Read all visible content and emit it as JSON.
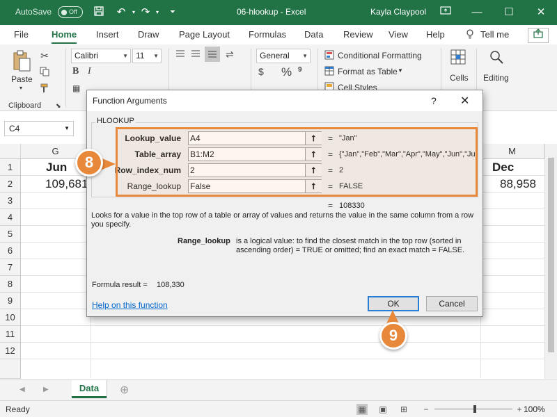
{
  "titlebar": {
    "autosave_label": "AutoSave",
    "autosave_state": "Off",
    "title": "06-hlookup  -  Excel",
    "user": "Kayla Claypool"
  },
  "ribbon_tabs": [
    "File",
    "Home",
    "Insert",
    "Draw",
    "Page Layout",
    "Formulas",
    "Data",
    "Review",
    "View",
    "Help"
  ],
  "tell_me": "Tell me",
  "ribbon": {
    "clipboard": {
      "paste": "Paste",
      "group": "Clipboard"
    },
    "font": {
      "name": "Calibri",
      "size": "11"
    },
    "number_format": "General",
    "styles": {
      "conditional": "Conditional Formatting",
      "format_table": "Format as Table",
      "cell_styles": "Cell Styles"
    },
    "cells": "Cells",
    "editing": "Editing"
  },
  "formula_bar": {
    "name_box": "C4"
  },
  "sheet": {
    "columns": [
      {
        "label": "G"
      },
      {
        "label": "M"
      }
    ],
    "rows": [
      "1",
      "2",
      "3",
      "4",
      "5",
      "6",
      "7",
      "8",
      "9",
      "10",
      "11",
      "12"
    ],
    "cells": {
      "g1": "Jun",
      "g2": "109,681",
      "m1": "Dec",
      "m2": "88,958"
    }
  },
  "sheet_tabs": [
    "Data"
  ],
  "status": {
    "ready": "Ready",
    "zoom": "100%"
  },
  "dialog": {
    "title": "Function Arguments",
    "help_glyph": "?",
    "close_glyph": "✕",
    "function_name": "HLOOKUP",
    "args": [
      {
        "label": "Lookup_value",
        "bold": true,
        "value": "A4",
        "result": "\"Jan\""
      },
      {
        "label": "Table_array",
        "bold": true,
        "value": "B1:M2",
        "result": "{\"Jan\",\"Feb\",\"Mar\",\"Apr\",\"May\",\"Jun\",\"Ju"
      },
      {
        "label": "Row_index_num",
        "bold": true,
        "value": "2",
        "result": "2"
      },
      {
        "label": "Range_lookup",
        "bold": false,
        "value": "False",
        "result": "FALSE"
      }
    ],
    "equals": "=",
    "overall_result": "108330",
    "description": "Looks for a value in the top row of a table or array of values and returns the value in the same column from a row you specify.",
    "arg_help_name": "Range_lookup",
    "arg_help_line1": "is a logical value: to find the closest match in the top row (sorted in",
    "arg_help_line2": "ascending order) = TRUE or omitted; find an exact match = FALSE.",
    "formula_result_label": "Formula result =",
    "formula_result_value": "108,330",
    "help_link": "Help on this function",
    "ok": "OK",
    "cancel": "Cancel"
  },
  "badges": {
    "step8": "8",
    "step9": "9"
  },
  "colors": {
    "excel_green": "#217346",
    "badge_orange": "#e8883a",
    "link_blue": "#0066cc"
  }
}
